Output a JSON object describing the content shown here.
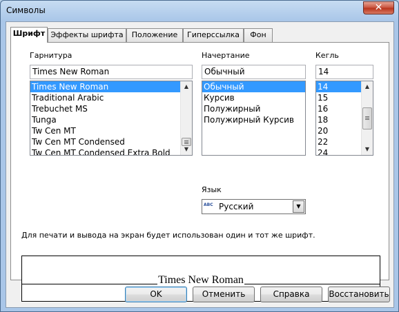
{
  "window": {
    "title": "Символы",
    "close_glyph": "✕"
  },
  "tabs": [
    {
      "label": "Шрифт",
      "active": true
    },
    {
      "label": "Эффекты шрифта",
      "active": false
    },
    {
      "label": "Положение",
      "active": false
    },
    {
      "label": "Гиперссылка",
      "active": false
    },
    {
      "label": "Фон",
      "active": false
    }
  ],
  "family": {
    "label": "Гарнитура",
    "value": "Times New Roman",
    "items": [
      "Times New Roman",
      "Traditional Arabic",
      "Trebuchet MS",
      "Tunga",
      "Tw Cen MT",
      "Tw Cen MT Condensed",
      "Tw Cen MT Condensed Extra Bold"
    ],
    "selected_index": 0
  },
  "style": {
    "label": "Начертание",
    "value": "Обычный",
    "items": [
      "Обычный",
      "Курсив",
      "Полужирный",
      "Полужирный Курсив"
    ],
    "selected_index": 0
  },
  "size": {
    "label": "Кегль",
    "value": "14",
    "items": [
      "14",
      "15",
      "16",
      "18",
      "20",
      "22",
      "24"
    ],
    "selected_index": 0
  },
  "language": {
    "label": "Язык",
    "value": "Русский",
    "flag_text": "ABC"
  },
  "info_text": "Для печати и вывода на экран будет использован один и тот же шрифт.",
  "preview": {
    "sample_text": "Times New Roman"
  },
  "buttons": {
    "ok": "OK",
    "cancel": "Отменить",
    "help": "Справка",
    "reset": "Восстановить"
  }
}
